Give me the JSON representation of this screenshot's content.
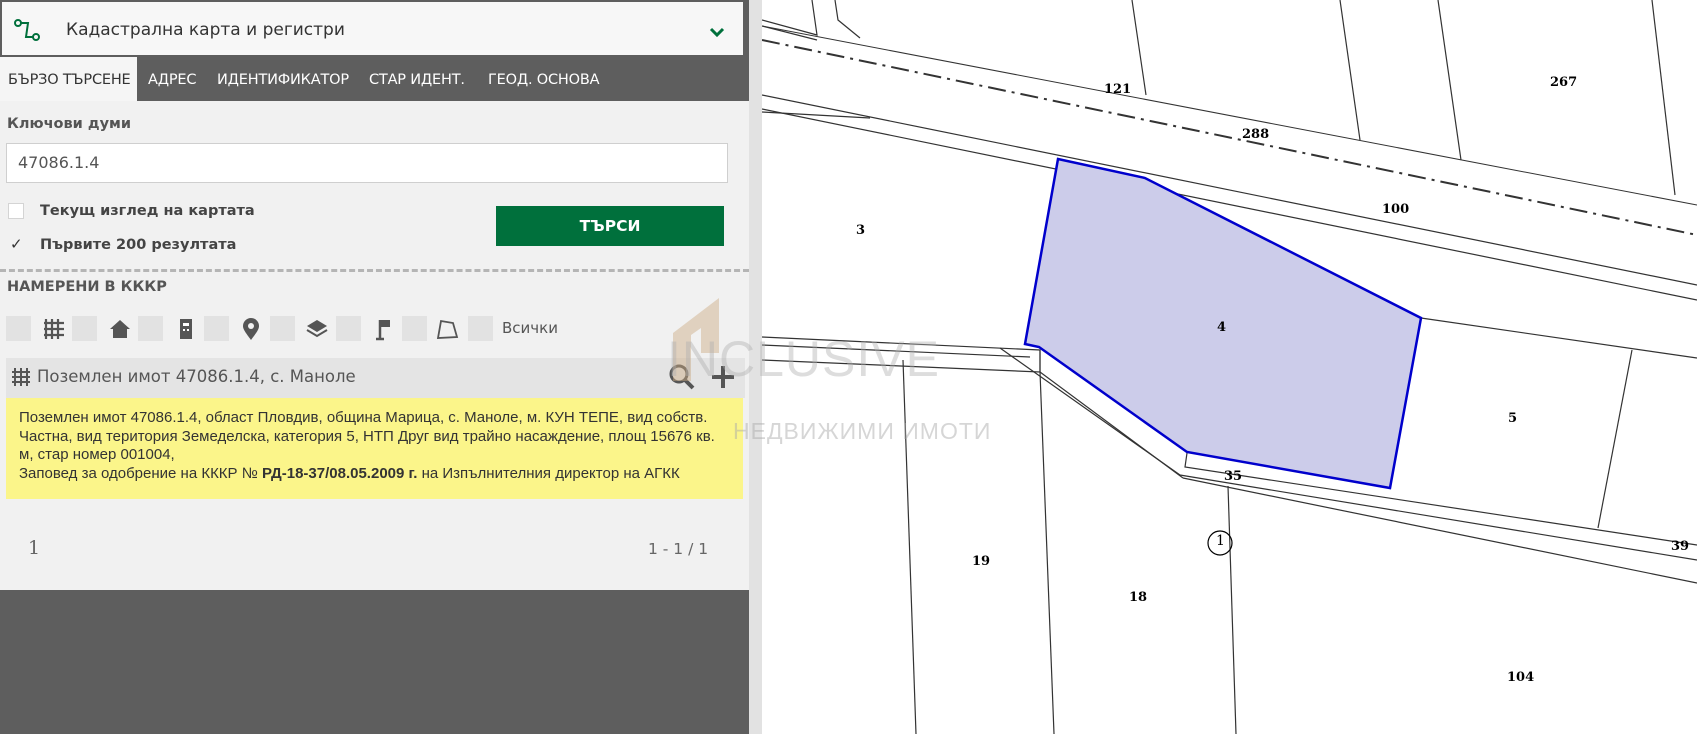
{
  "header": {
    "title": "Кадастрална карта и регистри"
  },
  "tabs": [
    "БЪРЗО ТЪРСЕНЕ",
    "АДРЕС",
    "ИДЕНТИФИКАТОР",
    "СТАР ИДЕНТ.",
    "ГЕОД. ОСНОВА"
  ],
  "search": {
    "keywords_label": "Ключови думи",
    "value": "47086.1.4",
    "current_view_label": "Текущ изглед на картата",
    "current_view_checked": false,
    "first_200_label": "Първите 200 резултата",
    "first_200_checked": true,
    "button_label": "ТЪРСИ"
  },
  "results": {
    "title": "НАМЕРЕНИ В КККР",
    "filter_icons": [
      "grid-icon",
      "home-icon",
      "building-icon",
      "pin-icon",
      "layers-icon",
      "flag-icon",
      "polygon-icon"
    ],
    "filter_all_label": "Всички",
    "item_label": "Поземлен имот 47086.1.4, с. Маноле",
    "info_text_1": "Поземлен имот 47086.1.4, област Пловдив, община Марица, с. Маноле, м. КУН ТЕПЕ, вид собств. Частна, вид територия Земеделска, категория 5, НТП Друг вид трайно насаждение, площ 15676 кв. м, стар номер 001004,",
    "info_text_2": "Заповед за одобрение на КККР №",
    "info_order": "РД-18-37/08.05.2009 г.",
    "info_text_3": "на Изпълнителния директор на АГКК",
    "page": "1",
    "range": "1 - 1 / 1"
  },
  "watermark": {
    "text": "INCLUSIVE",
    "subtext": "НЕДВИЖИМИ ИМОТИ"
  },
  "map": {
    "labels": {
      "l121": "121",
      "l267": "267",
      "l288": "288",
      "l100": "100",
      "l3": "3",
      "l4": "4",
      "l5": "5",
      "l35": "35",
      "l19": "19",
      "l18": "18",
      "l39": "39",
      "l104": "104",
      "l1": "1"
    },
    "highlight_fill": "#ccccea",
    "highlight_stroke": "#0000cc"
  },
  "colors": {
    "accent": "#00703c",
    "panel": "#5e5e5e",
    "info_bg": "#fbf58a"
  }
}
